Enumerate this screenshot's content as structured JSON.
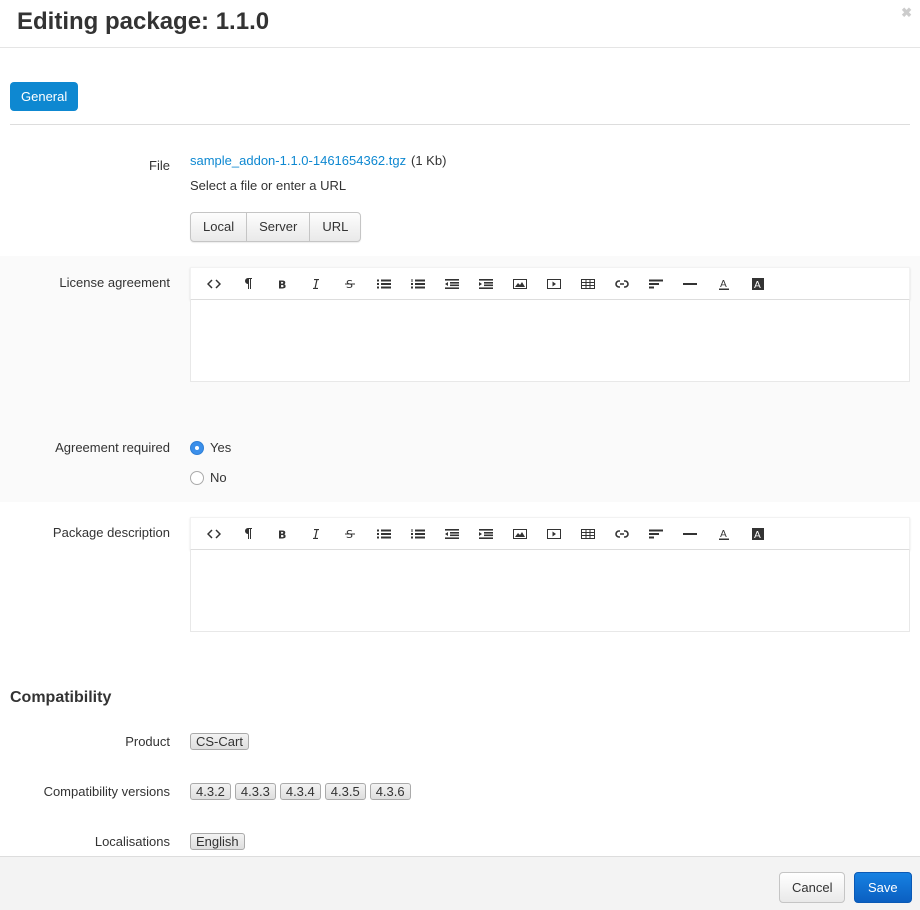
{
  "header": {
    "title": "Editing package: 1.1.0",
    "close_icon": "close-icon"
  },
  "tabs": [
    {
      "label": "General",
      "active": true
    }
  ],
  "file": {
    "label": "File",
    "link_text": "sample_addon-1.1.0-1461654362.tgz",
    "size": "(1 Kb)",
    "hint": "Select a file or enter a URL",
    "sources": [
      "Local",
      "Server",
      "URL"
    ]
  },
  "license": {
    "label": "License agreement",
    "content": ""
  },
  "agreement": {
    "label": "Agreement required",
    "options": [
      {
        "label": "Yes",
        "checked": true
      },
      {
        "label": "No",
        "checked": false
      }
    ]
  },
  "description": {
    "label": "Package description",
    "content": ""
  },
  "toolbar_icons": [
    "code-view",
    "paragraph",
    "bold",
    "italic",
    "strikethrough",
    "unordered-list",
    "ordered-list",
    "outdent",
    "indent",
    "image",
    "video",
    "table",
    "link",
    "align",
    "horizontal-rule",
    "font-color",
    "background-color"
  ],
  "compatibility": {
    "title": "Compatibility",
    "product_label": "Product",
    "product": "CS-Cart",
    "versions_label": "Compatibility versions",
    "versions": [
      "4.3.2",
      "4.3.3",
      "4.3.4",
      "4.3.5",
      "4.3.6"
    ],
    "localisations_label": "Localisations",
    "localisations": [
      "English"
    ]
  },
  "footer": {
    "cancel_label": "Cancel",
    "save_label": "Save"
  },
  "colors": {
    "accent": "#0e88d1",
    "save": "#0b66cc",
    "radio": "#3b8fea"
  }
}
